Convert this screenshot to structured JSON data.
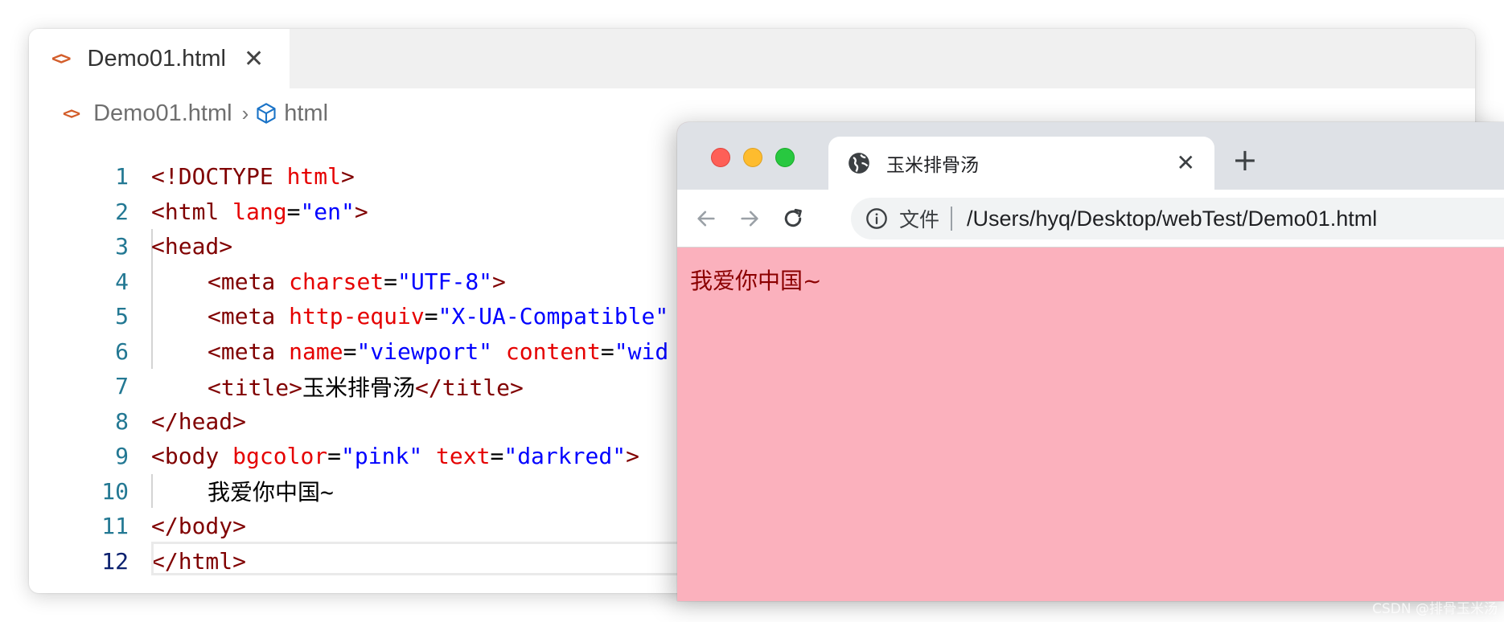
{
  "editor": {
    "tab": {
      "title": "Demo01.html",
      "close": "✕",
      "icon": "code-file-icon"
    },
    "breadcrumb": {
      "file": "Demo01.html",
      "separator": "›",
      "node": "html",
      "node_icon": "cube-icon"
    },
    "active_line": "12",
    "lines": [
      {
        "n": "1",
        "t": [
          "<!DOCTYPE ",
          "html",
          ">"
        ]
      },
      {
        "n": "2",
        "t": [
          "<html ",
          "lang",
          "=",
          "\"en\"",
          ">"
        ]
      },
      {
        "n": "3",
        "t": [
          "<head>"
        ]
      },
      {
        "n": "4",
        "t": [
          "<meta ",
          "charset",
          "=",
          "\"UTF-8\"",
          ">"
        ]
      },
      {
        "n": "5",
        "t": [
          "<meta ",
          "http-equiv",
          "=",
          "\"X-UA-Compatible\""
        ]
      },
      {
        "n": "6",
        "t": [
          "<meta ",
          "name",
          "=",
          "\"viewport\"",
          " ",
          "content",
          "=",
          "\"wid"
        ]
      },
      {
        "n": "7",
        "t": [
          "<title>",
          "玉米排骨汤",
          "</title>"
        ]
      },
      {
        "n": "8",
        "t": [
          "</head>"
        ]
      },
      {
        "n": "9",
        "t": [
          "<body ",
          "bgcolor",
          "=",
          "\"pink\"",
          " ",
          "text",
          "=",
          "\"darkred\"",
          ">"
        ]
      },
      {
        "n": "10",
        "t": [
          "我爱你中国~"
        ]
      },
      {
        "n": "11",
        "t": [
          "</body>"
        ]
      },
      {
        "n": "12",
        "t": [
          "</html>"
        ]
      }
    ]
  },
  "browser": {
    "tab": {
      "title": "玉米排骨汤",
      "close": "✕",
      "icon": "globe-icon"
    },
    "new_tab": "+",
    "omnibox": {
      "info_icon": "info-icon",
      "label": "文件",
      "url": "/Users/hyq/Desktop/webTest/Demo01.html"
    },
    "page": {
      "text": "我爱你中国~",
      "background": "#fbb1bd",
      "text_color": "#8b0000"
    }
  },
  "colors": {
    "tag": "#800000",
    "attr": "#e50000",
    "value": "#0000ff",
    "line_number": "#237893",
    "active_line_number": "#0b216f",
    "file_icon": "#d35d2a"
  },
  "watermark": "CSDN @排骨玉米汤"
}
